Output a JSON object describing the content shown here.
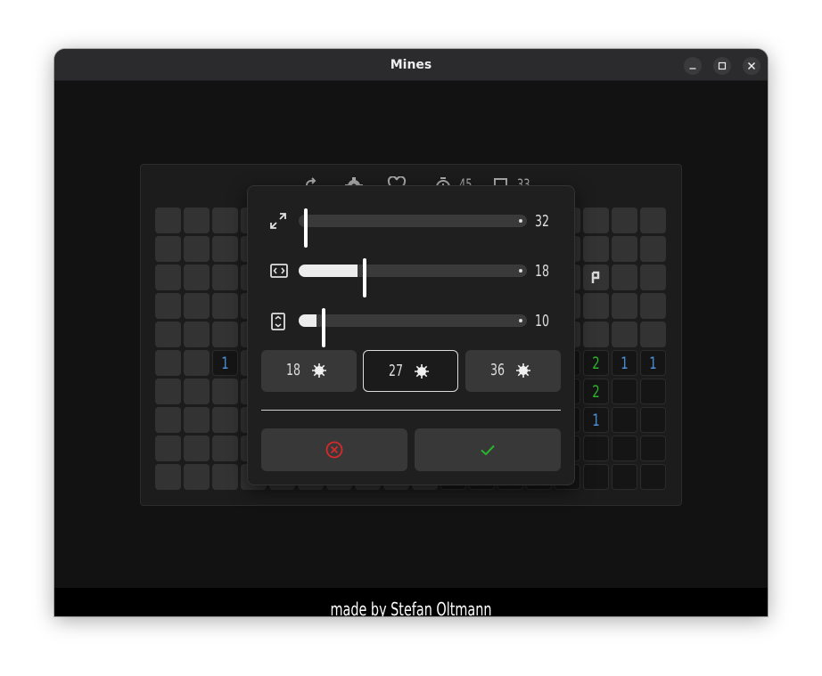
{
  "window": {
    "title": "Mines"
  },
  "toolbar": {
    "timer_value": "45",
    "flag_count": "33"
  },
  "board": {
    "columns": 18,
    "rows": 10,
    "flag_cell": "row 3, column 16",
    "numbers": [
      {
        "row": 5,
        "col": 2,
        "value": "1",
        "color": "#4a90d9"
      },
      {
        "row": 5,
        "col": 15,
        "value": "2",
        "color": "#2bb52b"
      },
      {
        "row": 5,
        "col": 16,
        "value": "1",
        "color": "#4a90d9"
      },
      {
        "row": 5,
        "col": 17,
        "value": "1",
        "color": "#4a90d9"
      },
      {
        "row": 6,
        "col": 15,
        "value": "2",
        "color": "#2bb52b"
      },
      {
        "row": 7,
        "col": 15,
        "value": "1",
        "color": "#4a90d9"
      }
    ]
  },
  "settings": {
    "sliders": [
      {
        "name": "size",
        "icon": "resize-icon",
        "value": "32",
        "level": 0.0
      },
      {
        "name": "width",
        "icon": "width-icon",
        "value": "18",
        "level": 0.28
      },
      {
        "name": "height",
        "icon": "height-icon",
        "value": "10",
        "level": 0.08
      }
    ],
    "mine_presets": [
      {
        "label": "18",
        "selected": false
      },
      {
        "label": "27",
        "selected": true
      },
      {
        "label": "36",
        "selected": false
      }
    ],
    "cancel_icon": "cancel-circle-icon",
    "confirm_icon": "checkmark-icon"
  },
  "footer": {
    "credit": "made by Stefan Oltmann"
  },
  "colors": {
    "cancel": "#d42a2a",
    "confirm": "#2bb52b",
    "number_one": "#4a90d9",
    "number_two": "#2bb52b"
  }
}
